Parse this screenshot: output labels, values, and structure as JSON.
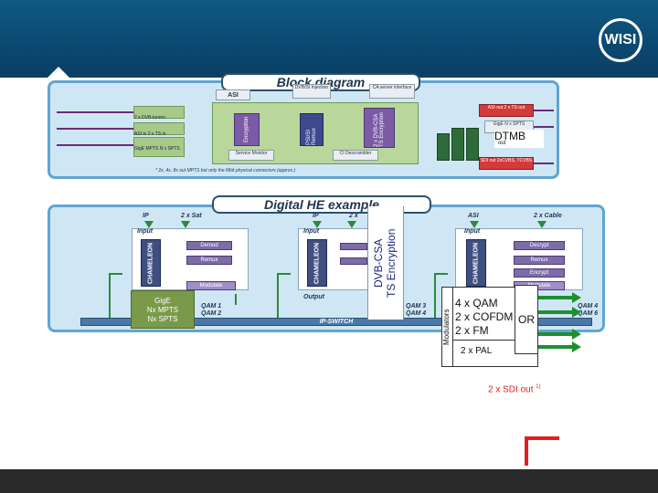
{
  "logo": {
    "text": "WISI"
  },
  "top_panel": {
    "title": "Block diagram",
    "inputs": [
      "2 x DVB-tuners",
      "ASI in 2 x TS in",
      "GigE MPTS N x SPTS"
    ],
    "top_labels": [
      "ASI",
      "DVB/SI Injection",
      "CA server interface"
    ],
    "blocks": [
      "Encryption",
      "PSI/SI Remux",
      "2 x DVB-CSA TS Encryption"
    ],
    "lower_blocks": [
      "Service Monitor",
      "CI Descrambler"
    ],
    "outputs": [
      "ASI out 2 x TS out",
      "GigE N x SPTS",
      "SDI out 2xCVBS, TCVBS"
    ],
    "footnote": "* 2x, 4x, 8x out MPTS but only the Mbit physical connectors (approx.)",
    "dtmb": "DTMB",
    "dtmb_sub": "out"
  },
  "bottom_panel": {
    "title": "Digital HE example",
    "col1": {
      "top": [
        "IP",
        "2 x Sat"
      ],
      "input": "Input",
      "chameleon": "CHAMELEON",
      "steps": [
        "Demod",
        "Remux",
        "Modulate"
      ]
    },
    "col2": {
      "top": [
        "IP",
        "2 x"
      ],
      "input": "Input",
      "chameleon": "CHAMELEON",
      "output": "Output"
    },
    "col3": {
      "top": [
        "ASI",
        "2 x Cable"
      ],
      "input": "Input",
      "chameleon": "CHAMELEON",
      "steps": [
        "Decrypt",
        "Remux",
        "Encrypt",
        "Modulate"
      ],
      "qam": [
        "QAM 4",
        "QAM 6"
      ]
    },
    "qam_left": [
      "QAM 1",
      "QAM 2"
    ],
    "qam_mid": [
      "QAM 3",
      "QAM 4"
    ],
    "ip_switch": "IP-SWITCH"
  },
  "overlays": {
    "gige": [
      "GigE",
      "Nx MPTS",
      "Nx SPTS"
    ],
    "dvb_csa": [
      "DVB-CSA",
      "TS Encryption"
    ],
    "modulators": "Modulators",
    "mod_lines": [
      "4 x QAM",
      "2 x COFDM",
      "2 x FM"
    ],
    "or": "OR",
    "pal": "2 x PAL",
    "sdi": "2 x SDI out",
    "sdi_sup": "1)"
  }
}
